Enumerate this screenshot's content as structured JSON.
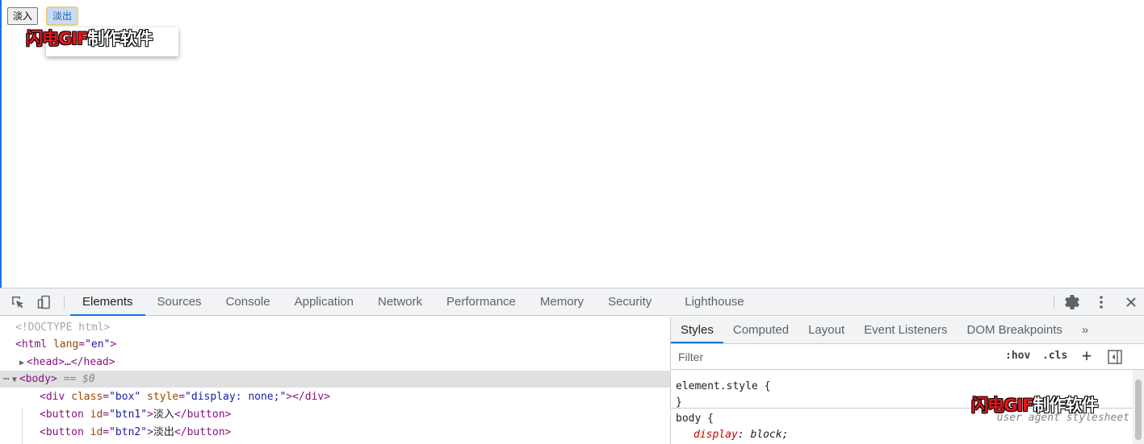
{
  "viewport": {
    "buttons": [
      {
        "label": "淡入"
      },
      {
        "label": "淡出"
      }
    ],
    "watermark": {
      "red_part": "闪电GIF",
      "white_part": "制作软件"
    }
  },
  "devtools": {
    "tabs": [
      "Elements",
      "Sources",
      "Console",
      "Application",
      "Network",
      "Performance",
      "Memory",
      "Security",
      "Lighthouse"
    ],
    "active_tab": "Elements",
    "tree": {
      "doctype": "<!DOCTYPE html>",
      "html_open": "<html",
      "html_attr": "lang",
      "html_val": "\"en\"",
      "head": "<head>…</head>",
      "body_tag": "<body>",
      "body_eq": "== $0",
      "div_line": {
        "open": "<div",
        "attr1": "class",
        "val1": "\"box\"",
        "attr2": "style",
        "val2": "\"display: none;\"",
        "close": "></div>"
      },
      "btn1_line": {
        "open": "<button",
        "attr": "id",
        "val": "\"btn1\"",
        "text": "淡入",
        "close": "</button>"
      },
      "btn2_line": {
        "open": "<button",
        "attr": "id",
        "val": "\"btn2\"",
        "text": "淡出",
        "close": "</button>"
      }
    },
    "styles": {
      "tabs": [
        "Styles",
        "Computed",
        "Layout",
        "Event Listeners",
        "DOM Breakpoints"
      ],
      "more": "»",
      "filter_placeholder": "Filter",
      "hov": ":hov",
      "cls": ".cls",
      "plus": "+",
      "element_style_open": "element.style {",
      "element_style_close": "}",
      "body_rule": "body {",
      "body_prop_name": "display",
      "body_prop_val": "block;",
      "ua_note": "user agent stylesheet"
    },
    "watermark": {
      "red_part": "闪电GIF",
      "white_part": "制作软件"
    }
  },
  "colors": {
    "accent": "#1a73e8",
    "tag": "#881280",
    "attr": "#994500",
    "value": "#1a1aa6",
    "watermark_red": "#e8151b"
  }
}
